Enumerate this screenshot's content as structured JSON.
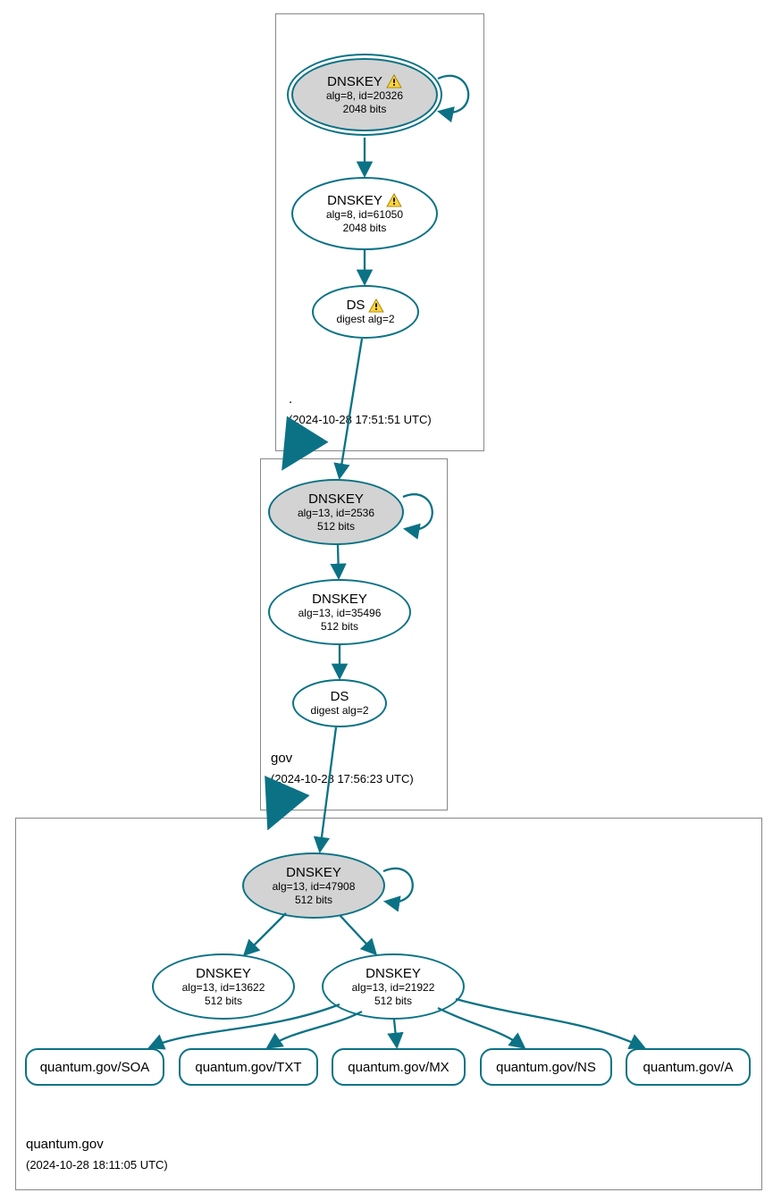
{
  "colors": {
    "stroke": "#0b7285",
    "ksk_fill": "#d3d3d3",
    "zone_border": "#888888"
  },
  "zones": {
    "root": {
      "name": ".",
      "timestamp": "(2024-10-28 17:51:51 UTC)"
    },
    "gov": {
      "name": "gov",
      "timestamp": "(2024-10-28 17:56:23 UTC)"
    },
    "quantum": {
      "name": "quantum.gov",
      "timestamp": "(2024-10-28 18:11:05 UTC)"
    }
  },
  "nodes": {
    "root_ksk": {
      "title": "DNSKEY",
      "warning": true,
      "line1": "alg=8, id=20326",
      "line2": "2048 bits"
    },
    "root_zsk": {
      "title": "DNSKEY",
      "warning": true,
      "line1": "alg=8, id=61050",
      "line2": "2048 bits"
    },
    "root_ds": {
      "title": "DS",
      "warning": true,
      "line1": "digest alg=2"
    },
    "gov_ksk": {
      "title": "DNSKEY",
      "warning": false,
      "line1": "alg=13, id=2536",
      "line2": "512 bits"
    },
    "gov_zsk": {
      "title": "DNSKEY",
      "warning": false,
      "line1": "alg=13, id=35496",
      "line2": "512 bits"
    },
    "gov_ds": {
      "title": "DS",
      "warning": false,
      "line1": "digest alg=2"
    },
    "quantum_ksk": {
      "title": "DNSKEY",
      "warning": false,
      "line1": "alg=13, id=47908",
      "line2": "512 bits"
    },
    "quantum_zsk1": {
      "title": "DNSKEY",
      "warning": false,
      "line1": "alg=13, id=13622",
      "line2": "512 bits"
    },
    "quantum_zsk2": {
      "title": "DNSKEY",
      "warning": false,
      "line1": "alg=13, id=21922",
      "line2": "512 bits"
    },
    "rr_soa": {
      "title": "quantum.gov/SOA"
    },
    "rr_txt": {
      "title": "quantum.gov/TXT"
    },
    "rr_mx": {
      "title": "quantum.gov/MX"
    },
    "rr_ns": {
      "title": "quantum.gov/NS"
    },
    "rr_a": {
      "title": "quantum.gov/A"
    }
  }
}
